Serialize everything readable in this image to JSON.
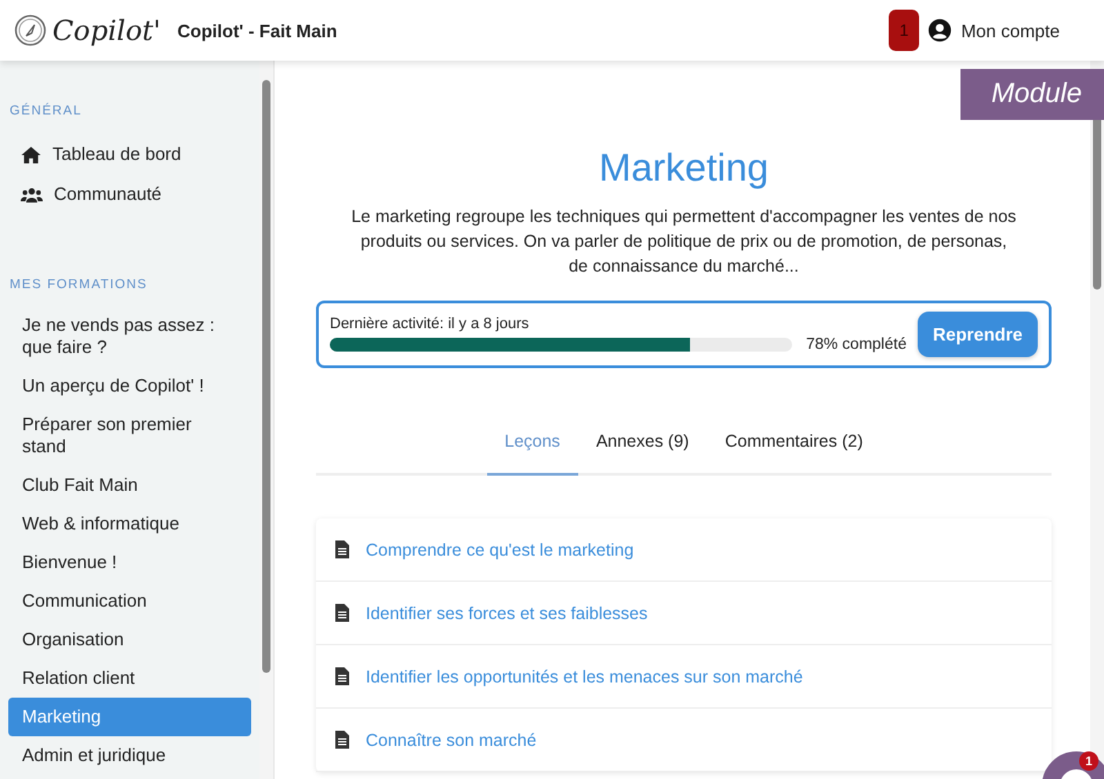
{
  "header": {
    "logo_text": "Copilot'",
    "title": "Copilot' - Fait Main",
    "notification_count": "1",
    "account_label": "Mon compte"
  },
  "sidebar": {
    "sections": [
      {
        "heading": "GÉNÉRAL",
        "items": [
          {
            "label": "Tableau de bord",
            "kind": "home",
            "selected": false
          },
          {
            "label": "Communauté",
            "kind": "community",
            "selected": false
          }
        ]
      },
      {
        "heading": "MES FORMATIONS",
        "items": [
          {
            "label": "Je ne vends pas assez : que faire ?",
            "selected": false
          },
          {
            "label": "Un aperçu de Copilot' !",
            "selected": false
          },
          {
            "label": "Préparer son premier stand",
            "selected": false
          },
          {
            "label": "Club Fait Main",
            "selected": false
          },
          {
            "label": "Web & informatique",
            "selected": false
          },
          {
            "label": "Bienvenue !",
            "selected": false
          },
          {
            "label": "Communication",
            "selected": false
          },
          {
            "label": "Organisation",
            "selected": false
          },
          {
            "label": "Relation client",
            "selected": false
          },
          {
            "label": "Marketing",
            "selected": true
          },
          {
            "label": "Admin et juridique",
            "selected": false
          }
        ]
      }
    ]
  },
  "module_tag": "Module",
  "module": {
    "title": "Marketing",
    "description": "Le marketing regroupe les techniques qui permettent d'accompagner les ventes de nos produits ou services. On va parler de politique de prix ou de promotion, de personas, de connaissance du marché...",
    "progress": {
      "last_activity": "Dernière activité: il y a 8 jours",
      "level": 0.78,
      "reading": "78% complété",
      "button": "Reprendre"
    }
  },
  "tabs": [
    {
      "label": "Leçons",
      "selected": true
    },
    {
      "label": "Annexes (9)",
      "selected": false
    },
    {
      "label": "Commentaires (2)",
      "selected": false
    }
  ],
  "lessons": [
    {
      "title": "Comprendre ce qu'est le marketing"
    },
    {
      "title": "Identifier ses forces et ses faiblesses"
    },
    {
      "title": "Identifier les opportunités et les menaces sur son marché"
    },
    {
      "title": "Connaître son marché"
    }
  ],
  "chat": {
    "badge": "1"
  }
}
